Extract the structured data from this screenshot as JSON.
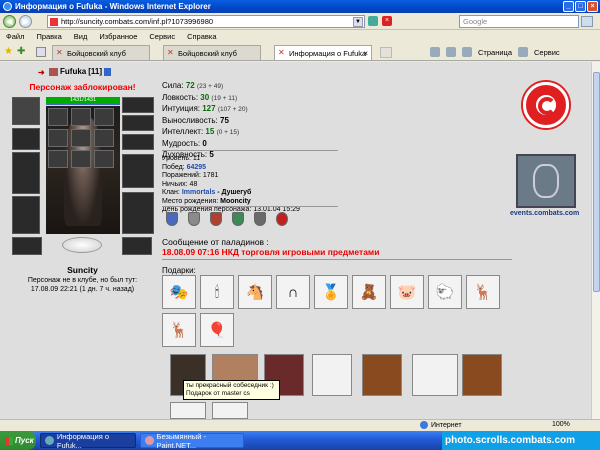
{
  "window": {
    "title": "Информация о Fufuka - Windows Internet Explorer"
  },
  "address": {
    "url": "http://suncity.combats.com/inf.pl?1073996980"
  },
  "search": {
    "placeholder": "Google"
  },
  "menu": [
    "Файл",
    "Правка",
    "Вид",
    "Избранное",
    "Сервис",
    "Справка"
  ],
  "tabs": [
    {
      "label": "Бойцовский клуб",
      "active": false
    },
    {
      "label": "Бойцовский клуб",
      "active": false
    },
    {
      "label": "Информация о Fufuka",
      "active": true
    }
  ],
  "toolbar": {
    "page_label": "Страница",
    "service_label": "Сервис"
  },
  "character": {
    "nick": "Fufuka",
    "level_tag": "[11]",
    "blocked": "Персонаж заблокирован!",
    "hp": "1431/1431",
    "city": "Suncity",
    "location_text": "Персонаж не в клубе, но был тут:",
    "last_seen": "17.08.09 22:21 (1 дн. 7 ч. назад)"
  },
  "stats": [
    {
      "label": "Сила:",
      "value": "72",
      "extra": "(23 + 49)"
    },
    {
      "label": "Ловкость:",
      "value": "30",
      "extra": "(19 + 11)"
    },
    {
      "label": "Интуиция:",
      "value": "127",
      "extra": "(107 + 20)"
    },
    {
      "label": "Выносливость:",
      "value": "75",
      "extra": ""
    },
    {
      "label": "Интеллект:",
      "value": "15",
      "extra": "(0 + 15)"
    },
    {
      "label": "Мудрость:",
      "value": "0",
      "extra": ""
    },
    {
      "label": "Духовность:",
      "value": "5",
      "extra": ""
    }
  ],
  "info": {
    "level": "Уровень: 11",
    "wins_label": "Побед:",
    "wins": "64295",
    "losses": "Поражений: 1781",
    "draws": "Ничьих: 48",
    "clan_label": "Клан:",
    "clan": "Immortals",
    "clan_rank": "- Душегуб",
    "birthplace_label": "Место рождения:",
    "birthplace": "Mooncity",
    "birthday": "День рождения персонажа: 13.01.04 15:29"
  },
  "paladin": {
    "heading": "Сообщение от паладинов :",
    "message": "18.08.09 07:16 НКД торговля игровыми предметами"
  },
  "gifts": {
    "label": "Подарки:",
    "tooltip_line1": "ты прекрасный собеседник :)",
    "tooltip_line2": "Подарок от master cs"
  },
  "banner": {
    "link": "events.combats.com"
  },
  "statusbar": {
    "zone": "Интернет",
    "zoom": "100%"
  },
  "taskbar": {
    "start": "Пуск",
    "items": [
      "Информация о Fufuk...",
      "Безымянный - Paint.NET..."
    ],
    "watermark": "photo.scrolls.combats.com"
  },
  "colors": {
    "accent_red": "#e00000",
    "stat_green": "#0b6a0b",
    "link_blue": "#1e4bb0"
  }
}
